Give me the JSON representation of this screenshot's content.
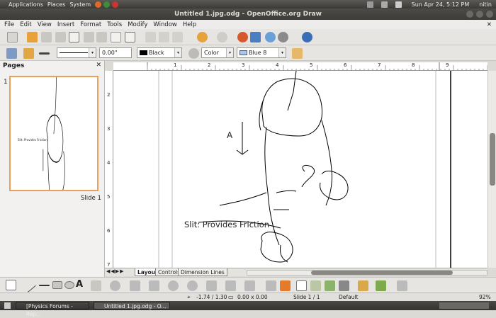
{
  "top_panel": {
    "menus": [
      "Applications",
      "Places",
      "System"
    ],
    "datetime": "Sun Apr 24,  5:12 PM",
    "user": "nitin"
  },
  "window": {
    "title": "Untitled 1.jpg.odg - OpenOffice.org Draw"
  },
  "menubar": [
    "File",
    "Edit",
    "View",
    "Insert",
    "Format",
    "Tools",
    "Modify",
    "Window",
    "Help"
  ],
  "line_props": {
    "width": "0.00\"",
    "line_color": "Black",
    "area_style": "Color",
    "area_color": "Blue 8"
  },
  "pages_pane": {
    "title": "Pages",
    "slide_number": "1",
    "slide_label": "Slide 1"
  },
  "ruler": {
    "h_ticks": [
      "1",
      "2",
      "3",
      "4",
      "5",
      "6",
      "7",
      "8",
      "9"
    ],
    "v_ticks": [
      "2",
      "3",
      "4",
      "5",
      "6",
      "7"
    ]
  },
  "drawing": {
    "label_a": "A",
    "caption": "Slit: Provides Friction",
    "thumb_caption": "Slit: Provides Friction"
  },
  "tabs": [
    "Layout",
    "Controls",
    "Dimension Lines"
  ],
  "status": {
    "position": "-1.74 / 1.30",
    "size": "0.00 x 0.00",
    "slide": "Slide 1 / 1",
    "layout": "Default",
    "zoom": "92%"
  },
  "taskbar": [
    "[Physics Forums - Rep...",
    "Untitled 1.jpg.odg - O..."
  ]
}
